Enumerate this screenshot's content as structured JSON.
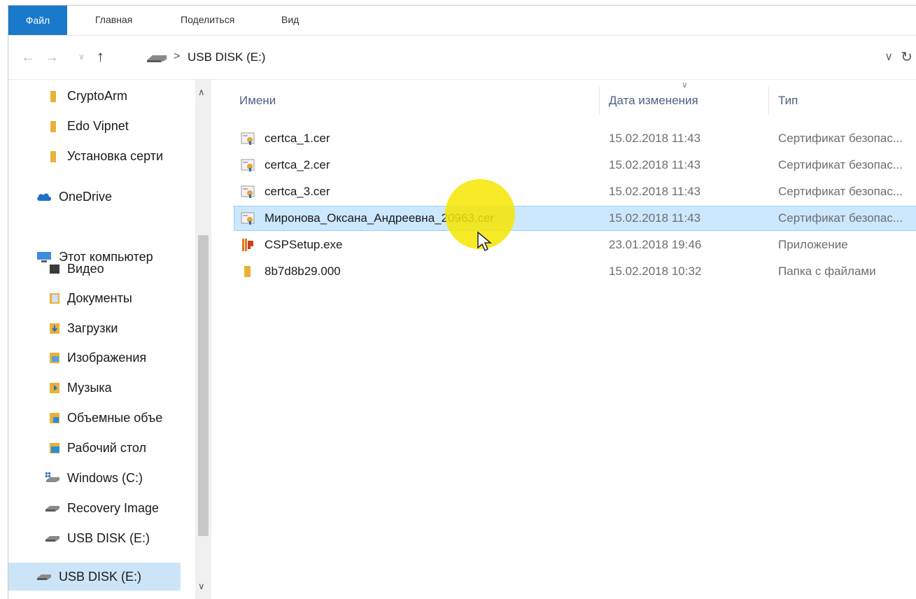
{
  "ribbon": {
    "tabs": [
      "Файл",
      "Главная",
      "Поделиться",
      "Вид"
    ]
  },
  "address": {
    "path": "USB DISK (E:)",
    "separator": ">"
  },
  "sidebar": {
    "items": [
      {
        "label": "CryptoArm",
        "icon": "folder-icon"
      },
      {
        "label": "Edo Vipnet",
        "icon": "folder-icon"
      },
      {
        "label": "Установка серти",
        "icon": "folder-icon"
      },
      {
        "label": "OneDrive",
        "icon": "onedrive-icon"
      },
      {
        "label": "Этот компьютер",
        "icon": "computer-icon"
      },
      {
        "label": "Видео",
        "icon": "video-folder-icon"
      },
      {
        "label": "Документы",
        "icon": "documents-folder-icon"
      },
      {
        "label": "Загрузки",
        "icon": "downloads-folder-icon"
      },
      {
        "label": "Изображения",
        "icon": "pictures-folder-icon"
      },
      {
        "label": "Музыка",
        "icon": "music-folder-icon"
      },
      {
        "label": "Объемные объе",
        "icon": "3d-objects-folder-icon"
      },
      {
        "label": "Рабочий стол",
        "icon": "desktop-folder-icon"
      },
      {
        "label": "Windows (C:)",
        "icon": "system-drive-icon"
      },
      {
        "label": "Recovery Image",
        "icon": "drive-icon"
      },
      {
        "label": "USB DISK (E:)",
        "icon": "usb-drive-icon"
      },
      {
        "label": "USB DISK (E:)",
        "icon": "usb-drive-icon",
        "selected": true
      }
    ]
  },
  "columns": {
    "name": "Имени",
    "date": "Дата изменения",
    "type": "Тип"
  },
  "files": [
    {
      "name": "certca_1.cer",
      "date": "15.02.2018 11:43",
      "type": "Сертификат безопас...",
      "icon": "certificate-icon"
    },
    {
      "name": "certca_2.cer",
      "date": "15.02.2018 11:43",
      "type": "Сертификат безопас...",
      "icon": "certificate-icon"
    },
    {
      "name": "certca_3.cer",
      "date": "15.02.2018 11:43",
      "type": "Сертификат безопас...",
      "icon": "certificate-icon"
    },
    {
      "name": "Миронова_Оксана_Андреевна_20963.cer",
      "date": "15.02.2018 11:43",
      "type": "Сертификат безопас...",
      "icon": "certificate-icon",
      "selected": true
    },
    {
      "name": "CSPSetup.exe",
      "date": "23.01.2018 19:46",
      "type": "Приложение",
      "icon": "installer-icon"
    },
    {
      "name": "8b7d8b29.000",
      "date": "15.02.2018 10:32",
      "type": "Папка с файлами",
      "icon": "folder-icon"
    }
  ],
  "colors": {
    "accent": "#1979ca",
    "selection": "#cce8ff",
    "highlight": "#f5e600"
  }
}
